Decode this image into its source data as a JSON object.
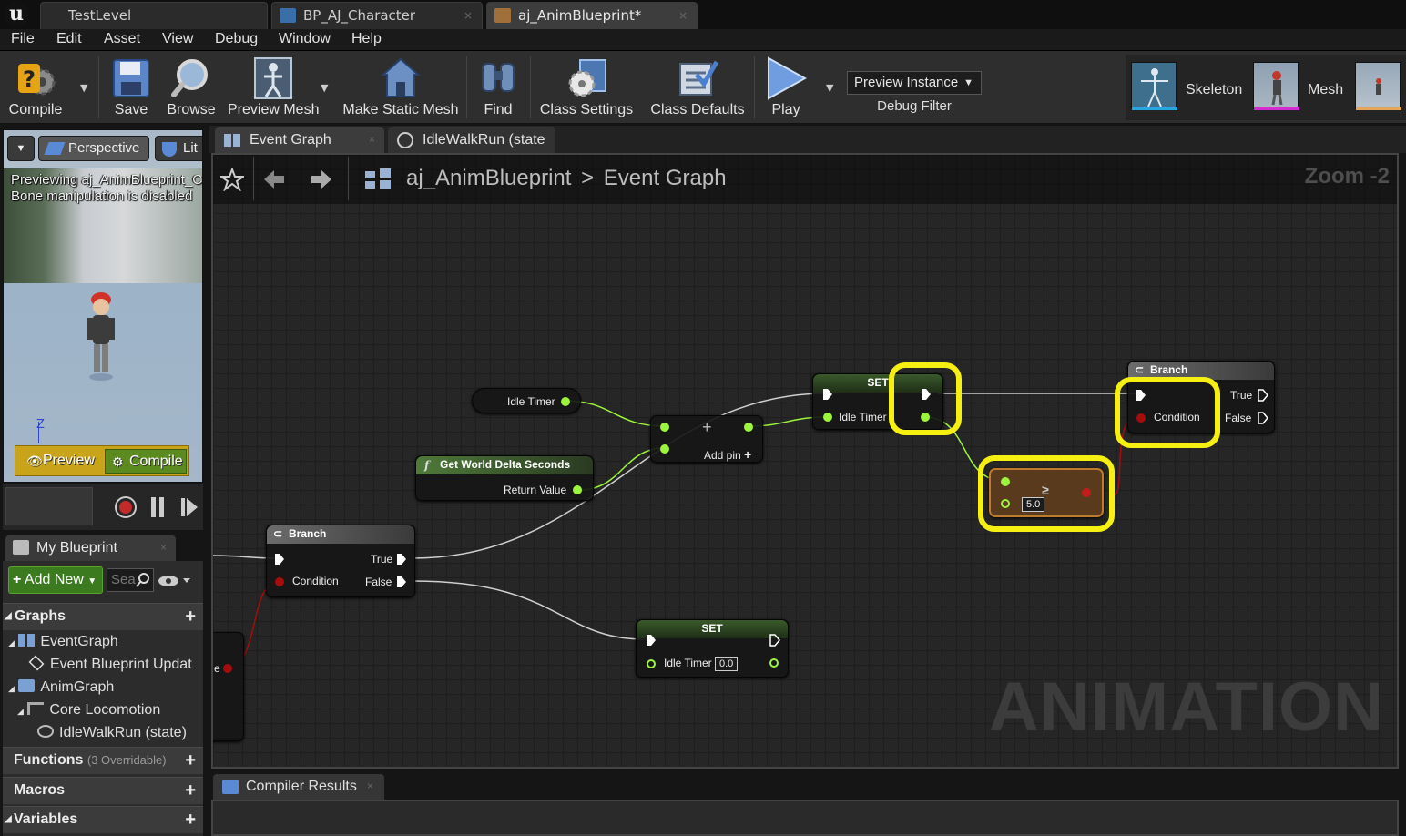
{
  "title_bar": {
    "tabs": [
      {
        "label": "TestLevel"
      },
      {
        "label": "BP_AJ_Character"
      },
      {
        "label": "aj_AnimBlueprint*"
      }
    ]
  },
  "menu": [
    "File",
    "Edit",
    "Asset",
    "View",
    "Debug",
    "Window",
    "Help"
  ],
  "toolbar": {
    "compile": "Compile",
    "save": "Save",
    "browse": "Browse",
    "preview_mesh": "Preview Mesh",
    "make_static_mesh": "Make Static Mesh",
    "find": "Find",
    "class_settings": "Class Settings",
    "class_defaults": "Class Defaults",
    "play": "Play",
    "preview_instance": "Preview Instance",
    "debug_filter": "Debug Filter",
    "modes": {
      "skeleton": "Skeleton",
      "mesh": "Mesh"
    }
  },
  "viewport": {
    "perspective": "Perspective",
    "lit": "Lit",
    "message_line1": "Previewing aj_AnimBlueprint_C",
    "message_line2": "Bone manipulation is disabled",
    "axis": "Z",
    "preview_button": "Preview",
    "compile_button": "Compile"
  },
  "my_blueprint": {
    "tab": "My Blueprint",
    "add_new": "Add New",
    "search_placeholder": "Sea",
    "sections": {
      "graphs": "Graphs",
      "functions": "Functions",
      "functions_sub": "(3 Overridable)",
      "macros": "Macros",
      "variables": "Variables"
    },
    "tree": [
      {
        "label": "EventGraph"
      },
      {
        "label": "Event Blueprint Updat"
      },
      {
        "label": "AnimGraph"
      },
      {
        "label": "Core Locomotion"
      },
      {
        "label": "IdleWalkRun (state)"
      }
    ]
  },
  "graph": {
    "tabs": [
      {
        "label": "Event Graph"
      },
      {
        "label": "IdleWalkRun (state"
      }
    ],
    "breadcrumb_root": "aj_AnimBlueprint",
    "breadcrumb_sep": ">",
    "breadcrumb_current": "Event Graph",
    "zoom": "Zoom -2",
    "watermark": "ANIMATION",
    "nodes": {
      "idle_timer_get": "Idle Timer",
      "delta_title": "Get World Delta Seconds",
      "delta_return": "Return Value",
      "add_pin": "Add pin",
      "set_top_title": "SET",
      "set_top_var": "Idle Timer",
      "compare_value": "5.0",
      "branch_right_title": "Branch",
      "branch_right_condition": "Condition",
      "branch_right_true": "True",
      "branch_right_false": "False",
      "branch_left_title": "Branch",
      "branch_left_condition": "Condition",
      "branch_left_true": "True",
      "branch_left_false": "False",
      "set_bottom_title": "SET",
      "set_bottom_var": "Idle Timer",
      "set_bottom_value": "0.0",
      "edge_pin_letter": "e"
    }
  },
  "compiler": {
    "tab": "Compiler Results"
  },
  "colors": {
    "highlight": "#f5ef12",
    "exec_wire": "#d8d8d8",
    "float_pin": "#9cf43c",
    "bool_pin": "#a50d0d",
    "add_new_green": "#3b7a1e",
    "preview_bar_gold": "#c9a41a"
  }
}
